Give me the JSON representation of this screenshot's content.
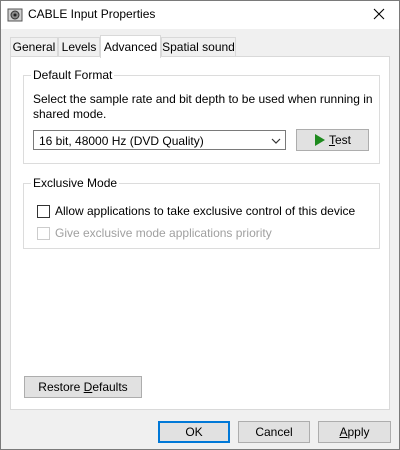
{
  "window": {
    "title": "CABLE Input Properties",
    "icons": {
      "app": "speaker-device-icon",
      "close": "close-icon"
    }
  },
  "tabs": [
    {
      "label": "General",
      "active": false
    },
    {
      "label": "Levels",
      "active": false
    },
    {
      "label": "Advanced",
      "active": true
    },
    {
      "label": "Spatial sound",
      "active": false
    }
  ],
  "default_format": {
    "group_label": "Default Format",
    "description": "Select the sample rate and bit depth to be used when running in shared mode.",
    "selected_format": "16 bit, 48000 Hz (DVD Quality)",
    "test_button": {
      "accel": "T",
      "rest": "est",
      "icon": "play-icon"
    },
    "play_icon_color": "#1e8a1e"
  },
  "exclusive_mode": {
    "group_label": "Exclusive Mode",
    "allow_exclusive": {
      "label": "Allow applications to take exclusive control of this device",
      "checked": false,
      "enabled": true
    },
    "priority": {
      "label": "Give exclusive mode applications priority",
      "checked": false,
      "enabled": false
    }
  },
  "restore_defaults": {
    "prefix": "Restore ",
    "accel": "D",
    "rest": "efaults"
  },
  "footer": {
    "ok_label": "OK",
    "cancel_label": "Cancel",
    "apply": {
      "accel": "A",
      "rest": "pply"
    }
  },
  "colors": {
    "accent": "#0078d7",
    "window_bg": "#f0f0f0",
    "panel_bg": "#ffffff"
  }
}
